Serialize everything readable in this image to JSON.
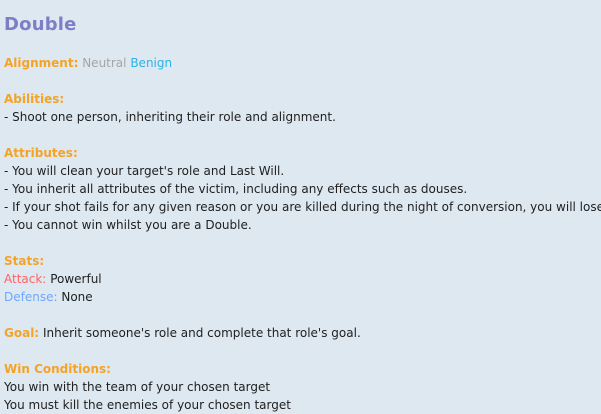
{
  "title": "Double",
  "alignment": {
    "label": "Alignment:",
    "faction": "Neutral",
    "subtype": "Benign"
  },
  "abilities": {
    "label": "Abilities:",
    "items": [
      "- Shoot one person, inheriting their role and alignment."
    ]
  },
  "attributes": {
    "label": "Attributes:",
    "items": [
      "- You will clean your target's role and Last Will.",
      "- You inherit all attributes of the victim, including any effects such as douses.",
      "- If your shot fails for any given reason or you are killed during the night of conversion, you will lose.",
      "- You cannot win whilst you are a Double."
    ]
  },
  "stats": {
    "label": "Stats:",
    "attack_label": "Attack:",
    "attack_value": "Powerful",
    "defense_label": "Defense:",
    "defense_value": "None"
  },
  "goal": {
    "label": "Goal:",
    "text": "Inherit someone's role and complete that role's goal."
  },
  "win_conditions": {
    "label": "Win Conditions:",
    "items": [
      "You win with the team of your chosen target",
      "You must kill the enemies of your chosen target"
    ]
  },
  "colors": {
    "background": "#dde8f1",
    "title": "#7e7ec6",
    "section_label": "#f5a325",
    "neutral": "#a6a6a6",
    "benign": "#29b3e8",
    "attack": "#ff6464",
    "defense": "#6ea7ff"
  }
}
